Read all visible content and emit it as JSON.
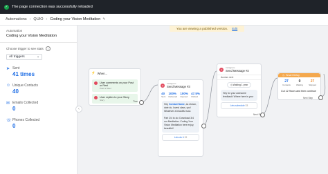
{
  "toast": {
    "message": "The page connection was successfully reloaded"
  },
  "breadcrumb": {
    "items": [
      "Automations",
      "QUIO",
      "Coding your Vision Meditation"
    ]
  },
  "sidebar": {
    "automation_label": "Automation",
    "automation_name": "Coding your Vision Meditation",
    "choose_trigger_label": "Choose trigger to see stats",
    "trigger_select_value": "All triggers",
    "stats": [
      {
        "label": "Sent",
        "value": "41 times",
        "icon": "send-icon"
      },
      {
        "label": "Unique Contacts",
        "value": "40",
        "icon": "contacts-icon"
      },
      {
        "label": "Emails Collected",
        "value": "0",
        "icon": "email-icon"
      },
      {
        "label": "Phones Collected",
        "value": "0",
        "icon": "phone-icon"
      }
    ]
  },
  "canvas": {
    "banner_text": "You are viewing a published version.",
    "banner_edit": "Edit",
    "trigger_node": {
      "title": "When...",
      "triggers": [
        {
          "title": "User comments on your Post or Reel",
          "sub": "Post or Reel"
        },
        {
          "title": "User replies to your Story",
          "sub": "Story"
        }
      ],
      "footer": "Then"
    },
    "message_node_1": {
      "sub": "Instagram",
      "title": "Send Message #3",
      "stats": [
        {
          "label": "Sent",
          "value": "40"
        },
        {
          "label": "Delivered",
          "value": "100%"
        },
        {
          "label": "Opened",
          "value": "100%"
        },
        {
          "label": "Clicked",
          "value": "47.5%"
        }
      ],
      "message_a": "Hey",
      "message_name": "Contact Name",
      "message_b": ", as shown, date do, lovest class, you! Whatever a beautiful soul.",
      "message_c": "Part 2/4 to do: Download 3/4 our Meditation. Coding Your Vision Meditation here  enjoy, beautiful!",
      "button": "Lets do it",
      "button_count": "19"
    },
    "message_node_2": {
      "sub": "Instagram",
      "title": "Send Message #2",
      "sub_item": "Access next",
      "waiting": "Waiting 1 year",
      "message": "Hey  for your awesome feedback! Where here is your",
      "button": "Lets schedule",
      "button_count": "33",
      "footer": "Next Step"
    },
    "smart_delay": {
      "title": "Smart Delay",
      "stats": [
        {
          "label": "Contacts",
          "value": "27"
        },
        {
          "label": "Waiting",
          "value": "0"
        },
        {
          "label": "Skipped",
          "value": "27"
        }
      ],
      "step": "Cut 12 Hours and then continue",
      "footer": "Next Step"
    }
  }
}
